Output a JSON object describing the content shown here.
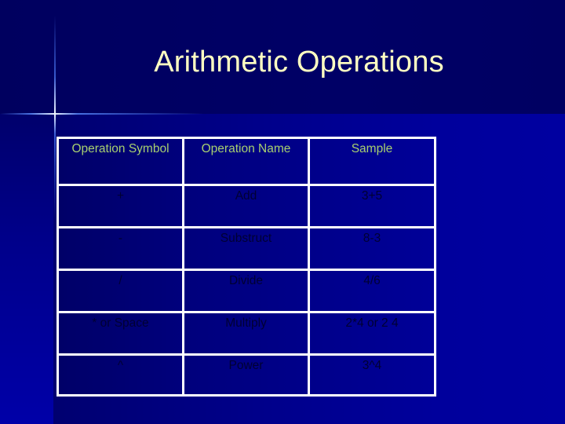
{
  "slide": {
    "title": "Arithmetic Operations",
    "colors": {
      "background_top": "#000066",
      "background_content": "#00009c",
      "title_text": "#ffffc2",
      "header_text": "#a8d070",
      "body_text": "#000033",
      "table_border": "#ffffff"
    }
  },
  "table": {
    "headers": [
      "Operation Symbol",
      "Operation Name",
      "Sample"
    ],
    "rows": [
      {
        "symbol": "+",
        "name": "Add",
        "sample": "3+5"
      },
      {
        "symbol": "-",
        "name": "Substruct",
        "sample": "8-3"
      },
      {
        "symbol": "/",
        "name": "Divide",
        "sample": "4/6"
      },
      {
        "symbol": "* or Space",
        "name": "Multiply",
        "sample": "2*4 or 2 4"
      },
      {
        "symbol": "^",
        "name": "Power",
        "sample": "3^4"
      }
    ]
  }
}
